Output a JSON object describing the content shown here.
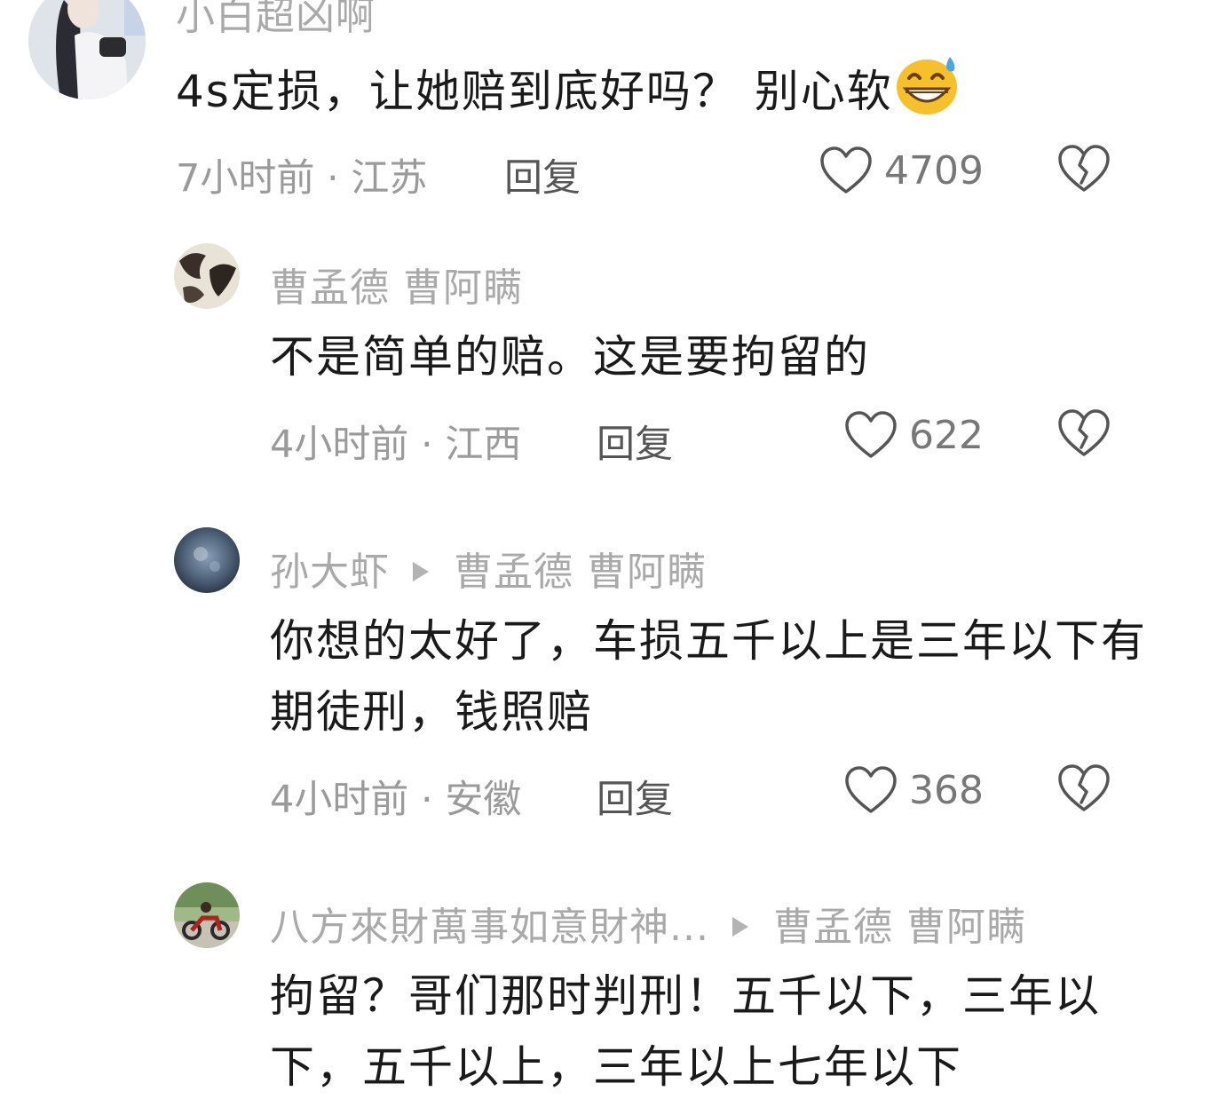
{
  "comments": [
    {
      "username": "小白超凶啊",
      "text": "4s定损，让她赔到底好吗？ 别心软",
      "emoji": "grinning-sweat-emoji",
      "time": "7小时前 · 江苏",
      "reply_label": "回复",
      "likes": "4709"
    },
    {
      "username": "曹孟德 曹阿瞒",
      "text": "不是简单的赔。这是要拘留的",
      "time": "4小时前 · 江西",
      "reply_label": "回复",
      "likes": "622"
    },
    {
      "username": "孙大虾",
      "reply_to": "曹孟德 曹阿瞒",
      "text": "你想的太好了，车损五千以上是三年以下有期徒刑，钱照赔",
      "time": "4小时前 · 安徽",
      "reply_label": "回复",
      "likes": "368"
    },
    {
      "username": "八方來財萬事如意財神...",
      "reply_to": "曹孟德 曹阿瞒",
      "text": "拘留？哥们那时判刑！五千以下，三年以下，五千以上，三年以上七年以下"
    }
  ],
  "colors": {
    "username": "#a9a9a9",
    "text": "#1a1a1a",
    "meta": "#9a9a9a",
    "icon": "#555555"
  }
}
